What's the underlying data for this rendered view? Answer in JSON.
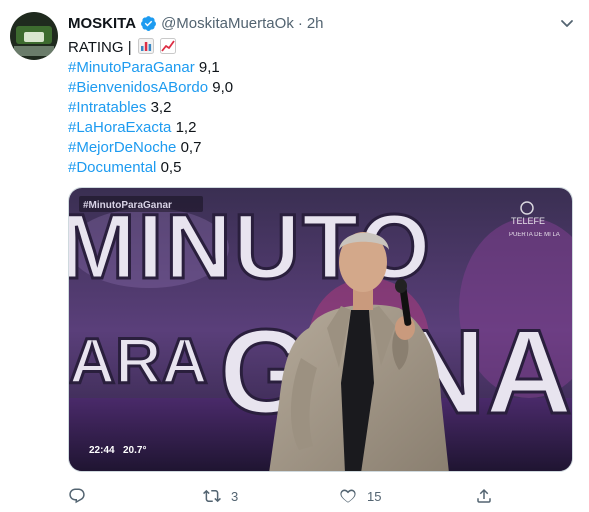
{
  "tweet": {
    "display_name": "MOSKITA",
    "handle": "@MoskitaMuertaOk",
    "separator": "·",
    "time": "2h",
    "text_intro": "RATING |",
    "ratings": [
      {
        "hashtag": "#MinutoParaGanar",
        "value": "9,1"
      },
      {
        "hashtag": "#BienvenidosABordo",
        "value": "9,0"
      },
      {
        "hashtag": "#Intratables",
        "value": "3,2"
      },
      {
        "hashtag": "#LaHoraExacta",
        "value": "1,2"
      },
      {
        "hashtag": "#MejorDeNoche",
        "value": "0,7"
      },
      {
        "hashtag": "#Documental",
        "value": "0,5"
      }
    ],
    "media": {
      "overlay_hashtag": "#MinutoParaGanar",
      "logo_text": "TELEFE",
      "logo_subtext": "PUERTA DE MI LA",
      "set_text_top": "MINUTO",
      "set_text_mid": "ARA",
      "set_text_bottom": "GANA",
      "clock": "22:44",
      "temperature": "20.7°"
    },
    "actions": {
      "reply_count": "",
      "retweet_count": "3",
      "like_count": "15"
    }
  },
  "colors": {
    "link": "#1d9bf0",
    "verified": "#1d9bf0",
    "secondary_text": "#536471"
  },
  "icons": [
    "verified-badge-icon",
    "chart-emoji-icon",
    "trend-up-emoji-icon",
    "more-caret-icon",
    "reply-icon",
    "retweet-icon",
    "like-icon",
    "share-icon"
  ]
}
